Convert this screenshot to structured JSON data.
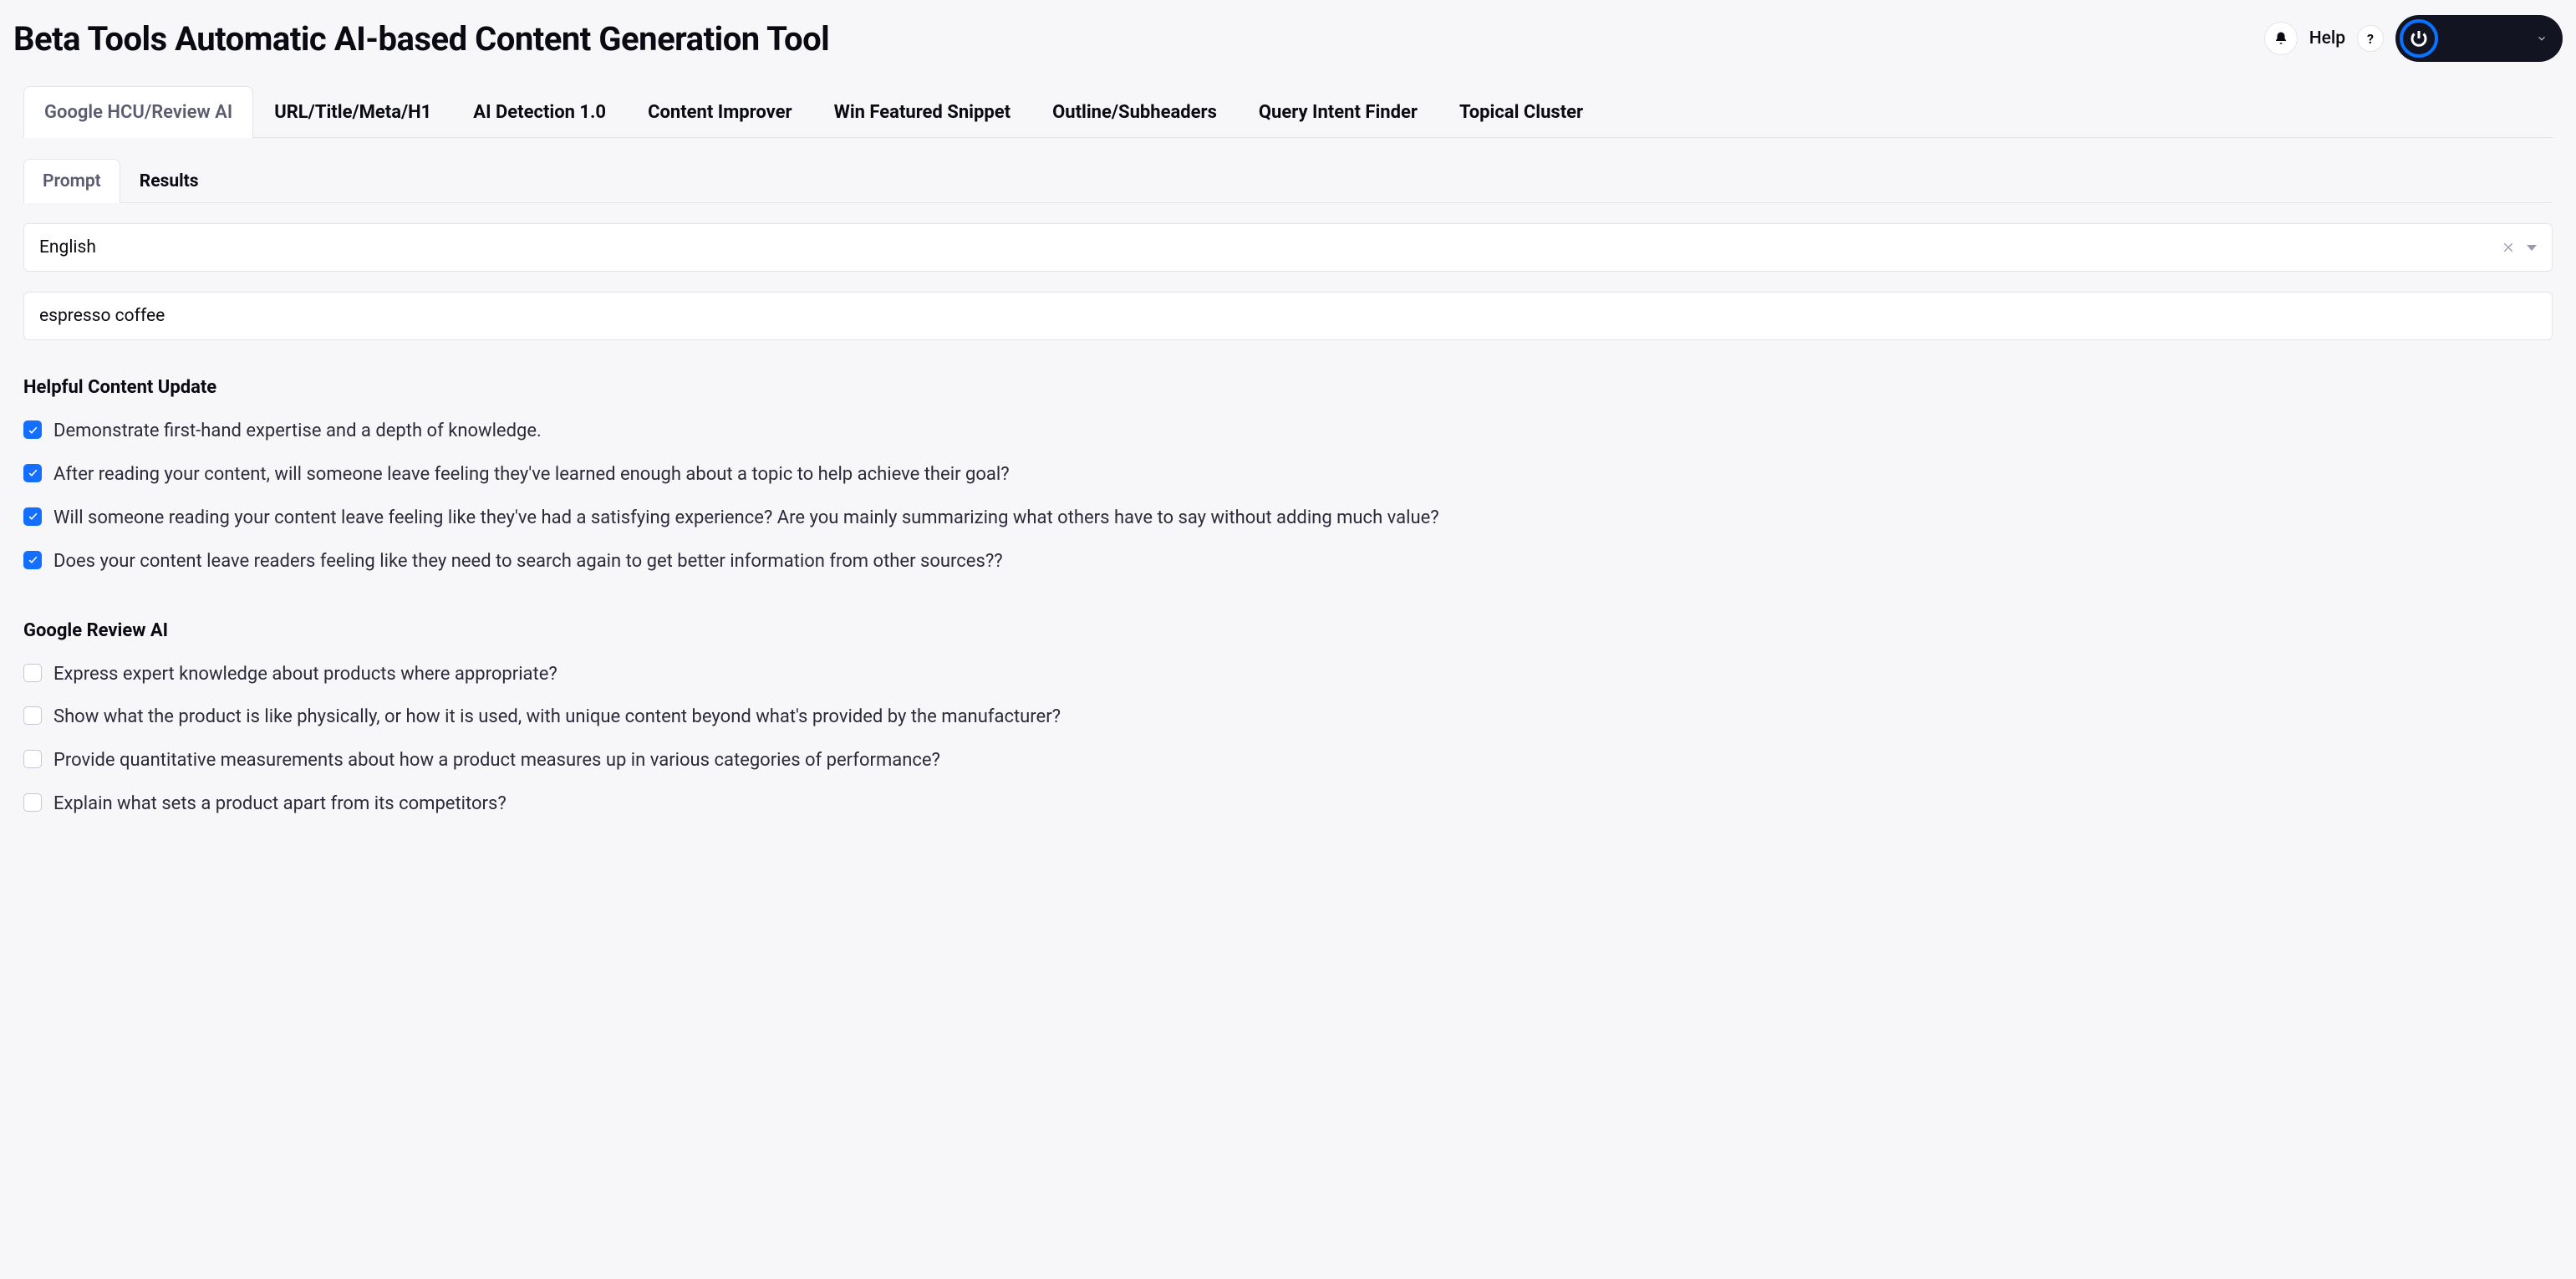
{
  "header": {
    "title": "Beta Tools Automatic AI-based Content Generation Tool",
    "help_label": "Help"
  },
  "tabs_primary": [
    {
      "label": "Google HCU/Review AI",
      "active": true
    },
    {
      "label": "URL/Title/Meta/H1",
      "active": false
    },
    {
      "label": "AI Detection 1.0",
      "active": false
    },
    {
      "label": "Content Improver",
      "active": false
    },
    {
      "label": "Win Featured Snippet",
      "active": false
    },
    {
      "label": "Outline/Subheaders",
      "active": false
    },
    {
      "label": "Query Intent Finder",
      "active": false
    },
    {
      "label": "Topical Cluster",
      "active": false
    }
  ],
  "tabs_secondary": [
    {
      "label": "Prompt",
      "active": true
    },
    {
      "label": "Results",
      "active": false
    }
  ],
  "language_select": {
    "value": "English"
  },
  "topic_input": {
    "value": "espresso coffee"
  },
  "sections": [
    {
      "title": "Helpful Content Update",
      "items": [
        {
          "checked": true,
          "label": "Demonstrate first-hand expertise and a depth of knowledge."
        },
        {
          "checked": true,
          "label": "After reading your content, will someone leave feeling they've learned enough about a topic to help achieve their goal?"
        },
        {
          "checked": true,
          "label": "Will someone reading your content leave feeling like they've had a satisfying experience? Are you mainly summarizing what others have to say without adding much value?"
        },
        {
          "checked": true,
          "label": "Does your content leave readers feeling like they need to search again to get better information from other sources??"
        }
      ]
    },
    {
      "title": "Google Review AI",
      "items": [
        {
          "checked": false,
          "label": "Express expert knowledge about products where appropriate?"
        },
        {
          "checked": false,
          "label": "Show what the product is like physically, or how it is used, with unique content beyond what's provided by the manufacturer?"
        },
        {
          "checked": false,
          "label": "Provide quantitative measurements about how a product measures up in various categories of performance?"
        },
        {
          "checked": false,
          "label": "Explain what sets a product apart from its competitors?"
        }
      ]
    }
  ]
}
